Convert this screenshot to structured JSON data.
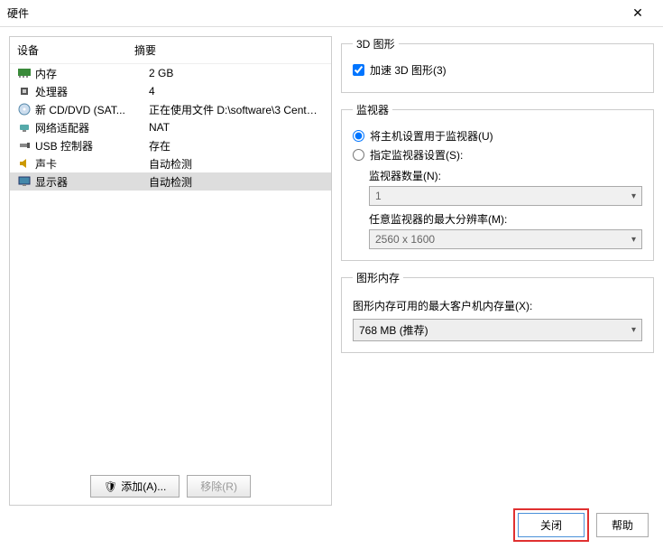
{
  "window": {
    "title": "硬件",
    "close_glyph": "✕"
  },
  "device_table": {
    "header_device": "设备",
    "header_summary": "摘要",
    "rows": [
      {
        "name": "内存",
        "summary": "2 GB",
        "icon": "memory"
      },
      {
        "name": "处理器",
        "summary": "4",
        "icon": "cpu"
      },
      {
        "name": "新 CD/DVD (SAT...",
        "summary": "正在使用文件 D:\\software\\3 CentO...",
        "icon": "cd"
      },
      {
        "name": "网络适配器",
        "summary": "NAT",
        "icon": "network"
      },
      {
        "name": "USB 控制器",
        "summary": "存在",
        "icon": "usb"
      },
      {
        "name": "声卡",
        "summary": "自动检测",
        "icon": "sound"
      },
      {
        "name": "显示器",
        "summary": "自动检测",
        "icon": "display",
        "selected": true
      }
    ]
  },
  "left_buttons": {
    "add": "添加(A)...",
    "remove": "移除(R)"
  },
  "group_3d": {
    "legend": "3D 图形",
    "accelerate_label": "加速 3D 图形(3)",
    "accelerate_checked": true
  },
  "group_monitor": {
    "legend": "监视器",
    "radio_host_label": "将主机设置用于监视器(U)",
    "radio_specify_label": "指定监视器设置(S):",
    "radio_selected": "host",
    "count_label": "监视器数量(N):",
    "count_value": "1",
    "maxres_label": "任意监视器的最大分辨率(M):",
    "maxres_value": "2560 x 1600"
  },
  "group_gmem": {
    "legend": "图形内存",
    "label": "图形内存可用的最大客户机内存量(X):",
    "value": "768 MB (推荐)"
  },
  "bottom": {
    "close": "关闭",
    "help": "帮助"
  },
  "icons": {
    "shield": "🛡"
  }
}
